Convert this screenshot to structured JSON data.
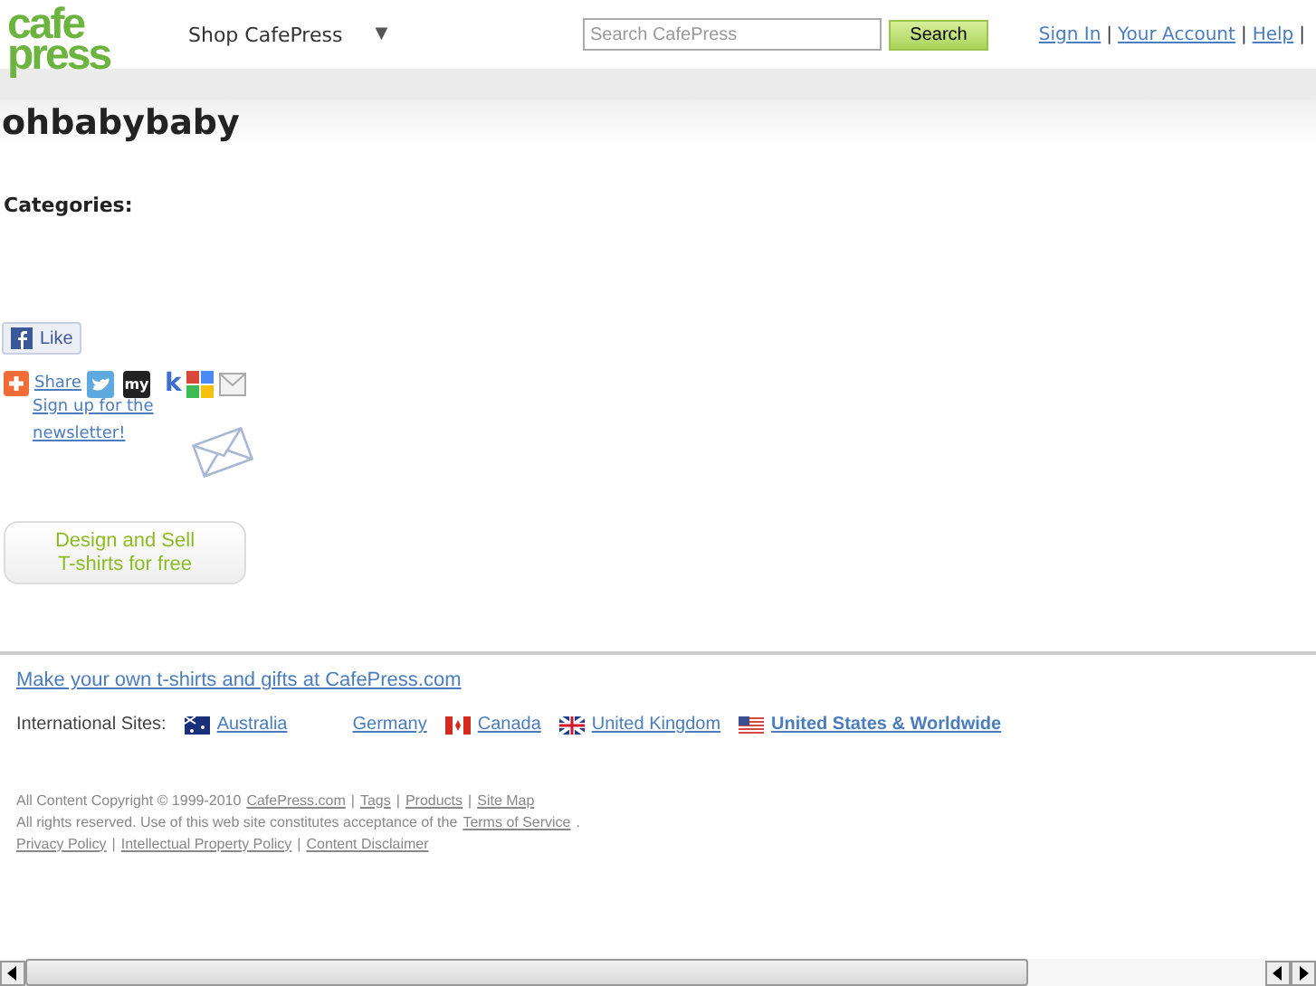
{
  "header": {
    "logo": [
      "cafe",
      "press"
    ],
    "shop_menu": {
      "label": "Shop CafePress",
      "caret": "▼"
    },
    "search": {
      "placeholder": "Search CafePress",
      "button": "Search"
    },
    "links": [
      {
        "label": "Sign In",
        "sep": "|"
      },
      {
        "label": "Your Account",
        "sep": "|"
      },
      {
        "label": "Help",
        "sep": "|"
      }
    ]
  },
  "title": "ohbabybaby",
  "categories_label": "Categories:",
  "like_button": "Like",
  "share": {
    "label": "Share",
    "myspace": "my",
    "k": "k"
  },
  "newsletter": "Sign up for the newsletter!",
  "design_button": [
    "Design and Sell",
    "T-shirts for free"
  ],
  "footer": {
    "promo_link": "Make your own t-shirts and gifts at CafePress.com",
    "intl_label": "International Sites:",
    "sites": [
      {
        "name": "Australia",
        "kind": "au",
        "selected": false
      },
      {
        "name": "Germany",
        "selected": false
      },
      {
        "name": "Canada",
        "kind": "ca",
        "selected": false
      },
      {
        "name": "United Kingdom",
        "kind": "uk",
        "selected": false
      },
      {
        "name": "United States & Worldwide",
        "kind": "us",
        "selected": true
      }
    ],
    "legal": [
      [
        {
          "kind": "text",
          "text": "All Content Copyright © 1999-2010"
        },
        {
          "kind": "link",
          "text": "CafePress.com"
        },
        {
          "kind": "text",
          "text": "|"
        },
        {
          "kind": "link",
          "text": "Tags"
        },
        {
          "kind": "text",
          "text": "|"
        },
        {
          "kind": "link",
          "text": "Products"
        },
        {
          "kind": "text",
          "text": "|"
        },
        {
          "kind": "link",
          "text": "Site Map"
        }
      ],
      [
        {
          "kind": "text",
          "text": "All rights reserved. Use of this web site constitutes acceptance of the"
        },
        {
          "kind": "link",
          "text": "Terms of Service"
        },
        {
          "kind": "text",
          "text": "."
        }
      ],
      [
        {
          "kind": "link",
          "text": "Privacy Policy"
        },
        {
          "kind": "text",
          "text": "|"
        },
        {
          "kind": "link",
          "text": "Intellectual Property Policy"
        },
        {
          "kind": "text",
          "text": "|"
        },
        {
          "kind": "link",
          "text": "Content Disclaimer"
        }
      ]
    ]
  }
}
